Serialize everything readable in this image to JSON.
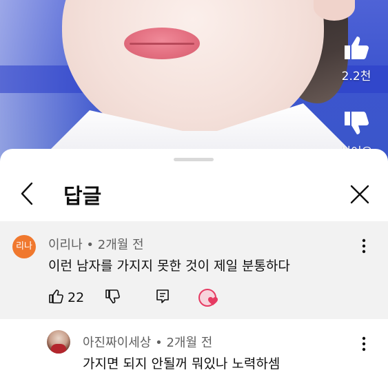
{
  "video": {
    "like_count": "2.2천",
    "dislike_label": "싫어요"
  },
  "sheet": {
    "title": "답글"
  },
  "comments": [
    {
      "avatar_text": "리나",
      "author": "이리나",
      "time": "2개월 전",
      "text": "이런 남자를 가지지 못한 것이 제일 분통하다",
      "likes": "22"
    },
    {
      "author": "아진짜이세상",
      "time": "2개월 전",
      "text": "가지면 되지 안될꺼 뭐있나 노력하셈"
    }
  ],
  "colors": {
    "avatar_main": "#f0782e",
    "heart": "#e63a62",
    "highlight_bg": "#f2f2f2"
  },
  "icons": [
    "thumbs-up-icon",
    "thumbs-down-icon",
    "back-arrow-icon",
    "close-icon",
    "more-vert-icon",
    "reply-icon",
    "creator-heart-icon"
  ]
}
